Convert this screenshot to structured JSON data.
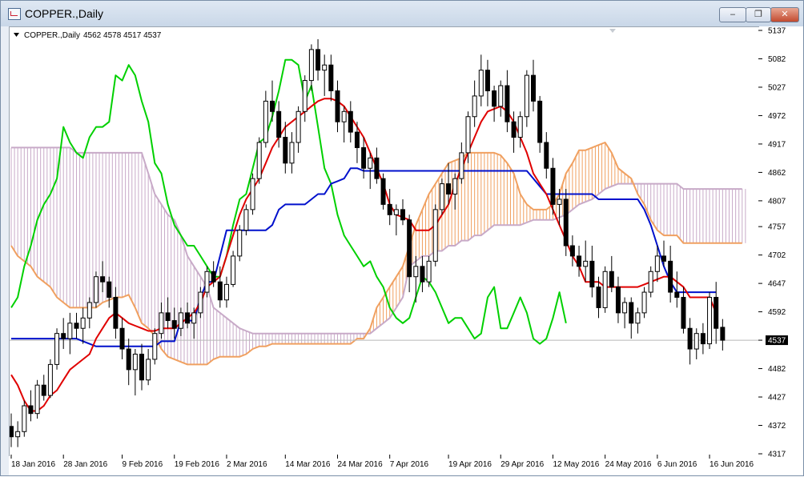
{
  "window": {
    "title": "COPPER.,Daily",
    "minimize_label": "‒",
    "restore_label": "❐",
    "close_label": "✕"
  },
  "chart_header": {
    "symbol": "COPPER.,Daily",
    "ohlc": "4562 4578 4517 4537"
  },
  "colors": {
    "tenkan": "#e00000",
    "kijun": "#0010cc",
    "chikou": "#00d000",
    "senkou_a": "#f0a060",
    "senkou_b": "#c8aac8",
    "bull_body": "#ffffff",
    "bear_body": "#000000",
    "price_line": "#b8b8b8"
  },
  "chart_data": {
    "type": "candlestick",
    "indicator": "Ichimoku Kinko Hyo",
    "ylim": [
      4317,
      5137
    ],
    "y_ticks": [
      5137,
      5082,
      5027,
      4972,
      4917,
      4862,
      4807,
      4757,
      4702,
      4647,
      4592,
      4537,
      4482,
      4427,
      4372,
      4317
    ],
    "x_tick_labels": [
      "18 Jan 2016",
      "28 Jan 2016",
      "9 Feb 2016",
      "19 Feb 2016",
      "2 Mar 2016",
      "14 Mar 2016",
      "24 Mar 2016",
      "7 Apr 2016",
      "19 Apr 2016",
      "29 Apr 2016",
      "12 May 2016",
      "24 May 2016",
      "6 Jun 2016",
      "16 Jun 2016"
    ],
    "x_tick_bars": [
      0,
      8,
      17,
      25,
      33,
      42,
      50,
      58,
      67,
      75,
      83,
      91,
      99,
      107
    ],
    "current_price": 4537,
    "candles": [
      [
        4370,
        4395,
        4330,
        4350
      ],
      [
        4350,
        4380,
        4330,
        4360
      ],
      [
        4360,
        4420,
        4350,
        4410
      ],
      [
        4410,
        4440,
        4380,
        4395
      ],
      [
        4395,
        4460,
        4385,
        4450
      ],
      [
        4450,
        4470,
        4420,
        4430
      ],
      [
        4430,
        4500,
        4425,
        4490
      ],
      [
        4490,
        4560,
        4480,
        4550
      ],
      [
        4550,
        4580,
        4520,
        4540
      ],
      [
        4540,
        4590,
        4510,
        4570
      ],
      [
        4570,
        4590,
        4540,
        4560
      ],
      [
        4560,
        4600,
        4530,
        4580
      ],
      [
        4580,
        4620,
        4560,
        4610
      ],
      [
        4610,
        4670,
        4600,
        4660
      ],
      [
        4660,
        4690,
        4630,
        4650
      ],
      [
        4650,
        4660,
        4600,
        4620
      ],
      [
        4620,
        4640,
        4540,
        4560
      ],
      [
        4560,
        4580,
        4500,
        4520
      ],
      [
        4520,
        4540,
        4450,
        4480
      ],
      [
        4480,
        4520,
        4430,
        4510
      ],
      [
        4510,
        4530,
        4440,
        4460
      ],
      [
        4460,
        4520,
        4450,
        4500
      ],
      [
        4500,
        4560,
        4490,
        4550
      ],
      [
        4550,
        4610,
        4540,
        4590
      ],
      [
        4590,
        4620,
        4560,
        4575
      ],
      [
        4575,
        4600,
        4540,
        4560
      ],
      [
        4560,
        4600,
        4545,
        4590
      ],
      [
        4590,
        4610,
        4560,
        4570
      ],
      [
        4570,
        4600,
        4540,
        4590
      ],
      [
        4590,
        4640,
        4580,
        4630
      ],
      [
        4630,
        4680,
        4620,
        4670
      ],
      [
        4670,
        4690,
        4640,
        4650
      ],
      [
        4650,
        4680,
        4600,
        4615
      ],
      [
        4615,
        4660,
        4600,
        4645
      ],
      [
        4645,
        4710,
        4640,
        4700
      ],
      [
        4700,
        4760,
        4690,
        4750
      ],
      [
        4750,
        4800,
        4740,
        4790
      ],
      [
        4790,
        4860,
        4780,
        4850
      ],
      [
        4850,
        4930,
        4840,
        4920
      ],
      [
        4920,
        5020,
        4910,
        5000
      ],
      [
        5000,
        5040,
        4960,
        4980
      ],
      [
        4980,
        5000,
        4910,
        4930
      ],
      [
        4930,
        4960,
        4860,
        4880
      ],
      [
        4880,
        4940,
        4860,
        4920
      ],
      [
        4920,
        4990,
        4900,
        4980
      ],
      [
        4980,
        5050,
        4960,
        5040
      ],
      [
        5040,
        5110,
        5020,
        5100
      ],
      [
        5100,
        5120,
        5040,
        5060
      ],
      [
        5060,
        5090,
        5010,
        5070
      ],
      [
        5070,
        5090,
        5000,
        5020
      ],
      [
        5020,
        5040,
        4940,
        4960
      ],
      [
        4960,
        4990,
        4920,
        4980
      ],
      [
        4980,
        5000,
        4920,
        4940
      ],
      [
        4940,
        4960,
        4880,
        4910
      ],
      [
        4910,
        4930,
        4850,
        4870
      ],
      [
        4870,
        4900,
        4830,
        4890
      ],
      [
        4890,
        4910,
        4840,
        4850
      ],
      [
        4850,
        4860,
        4790,
        4800
      ],
      [
        4800,
        4830,
        4760,
        4780
      ],
      [
        4780,
        4800,
        4740,
        4790
      ],
      [
        4790,
        4810,
        4760,
        4770
      ],
      [
        4770,
        4780,
        4630,
        4660
      ],
      [
        4660,
        4700,
        4610,
        4680
      ],
      [
        4680,
        4700,
        4630,
        4650
      ],
      [
        4650,
        4700,
        4640,
        4690
      ],
      [
        4690,
        4800,
        4680,
        4790
      ],
      [
        4790,
        4850,
        4780,
        4840
      ],
      [
        4840,
        4880,
        4800,
        4820
      ],
      [
        4820,
        4860,
        4790,
        4850
      ],
      [
        4850,
        4920,
        4840,
        4900
      ],
      [
        4900,
        4980,
        4880,
        4970
      ],
      [
        4970,
        5040,
        4950,
        5010
      ],
      [
        5010,
        5090,
        4990,
        5060
      ],
      [
        5060,
        5080,
        4990,
        5020
      ],
      [
        5020,
        5030,
        4960,
        4990
      ],
      [
        4990,
        5040,
        4970,
        5030
      ],
      [
        5030,
        5060,
        4940,
        4960
      ],
      [
        4960,
        4980,
        4900,
        4930
      ],
      [
        4930,
        4980,
        4910,
        4970
      ],
      [
        4970,
        5060,
        4950,
        5050
      ],
      [
        5050,
        5080,
        4980,
        5000
      ],
      [
        5000,
        5010,
        4900,
        4920
      ],
      [
        4920,
        4940,
        4850,
        4870
      ],
      [
        4870,
        4890,
        4780,
        4800
      ],
      [
        4800,
        4830,
        4760,
        4810
      ],
      [
        4810,
        4830,
        4700,
        4720
      ],
      [
        4720,
        4740,
        4680,
        4700
      ],
      [
        4700,
        4720,
        4660,
        4680
      ],
      [
        4680,
        4730,
        4650,
        4690
      ],
      [
        4690,
        4720,
        4620,
        4640
      ],
      [
        4640,
        4660,
        4580,
        4600
      ],
      [
        4600,
        4680,
        4590,
        4670
      ],
      [
        4670,
        4700,
        4630,
        4640
      ],
      [
        4640,
        4660,
        4570,
        4590
      ],
      [
        4590,
        4620,
        4560,
        4610
      ],
      [
        4610,
        4620,
        4540,
        4570
      ],
      [
        4570,
        4600,
        4550,
        4590
      ],
      [
        4590,
        4640,
        4580,
        4630
      ],
      [
        4630,
        4680,
        4620,
        4670
      ],
      [
        4670,
        4720,
        4650,
        4700
      ],
      [
        4700,
        4730,
        4680,
        4690
      ],
      [
        4690,
        4720,
        4610,
        4630
      ],
      [
        4630,
        4670,
        4600,
        4620
      ],
      [
        4620,
        4640,
        4550,
        4560
      ],
      [
        4560,
        4580,
        4490,
        4520
      ],
      [
        4520,
        4560,
        4500,
        4550
      ],
      [
        4550,
        4570,
        4510,
        4530
      ],
      [
        4530,
        4630,
        4520,
        4620
      ],
      [
        4620,
        4650,
        4530,
        4560
      ],
      [
        4562,
        4578,
        4517,
        4537
      ]
    ],
    "tenkan": [
      4470,
      4450,
      4420,
      4400,
      4400,
      4410,
      4430,
      4440,
      4460,
      4480,
      4490,
      4500,
      4510,
      4540,
      4560,
      4580,
      4590,
      4580,
      4570,
      4565,
      4560,
      4555,
      4555,
      4560,
      4560,
      4560,
      4570,
      4580,
      4590,
      4610,
      4640,
      4650,
      4660,
      4700,
      4740,
      4780,
      4810,
      4830,
      4850,
      4880,
      4910,
      4930,
      4950,
      4960,
      4970,
      4980,
      4990,
      5000,
      5005,
      5005,
      5000,
      4990,
      4970,
      4950,
      4930,
      4900,
      4870,
      4840,
      4800,
      4780,
      4775,
      4770,
      4750,
      4750,
      4750,
      4760,
      4780,
      4800,
      4840,
      4870,
      4900,
      4930,
      4960,
      4980,
      4985,
      4990,
      4980,
      4960,
      4930,
      4900,
      4860,
      4840,
      4820,
      4790,
      4760,
      4730,
      4700,
      4680,
      4650,
      4650,
      4650,
      4640,
      4640,
      4640,
      4640,
      4640,
      4640,
      4645,
      4650,
      4655,
      4660,
      4660,
      4650,
      4640,
      4620,
      4620,
      4620,
      4620,
      4590
    ],
    "kijun": [
      4540,
      4540,
      4540,
      4540,
      4540,
      4540,
      4540,
      4540,
      4540,
      4540,
      4540,
      4535,
      4530,
      4525,
      4525,
      4525,
      4525,
      4525,
      4525,
      4525,
      4525,
      4525,
      4525,
      4535,
      4535,
      4535,
      4575,
      4575,
      4575,
      4620,
      4650,
      4650,
      4700,
      4750,
      4750,
      4750,
      4750,
      4750,
      4750,
      4750,
      4760,
      4790,
      4800,
      4800,
      4800,
      4800,
      4810,
      4820,
      4820,
      4840,
      4845,
      4850,
      4870,
      4870,
      4865,
      4865,
      4865,
      4865,
      4865,
      4865,
      4865,
      4865,
      4865,
      4865,
      4865,
      4865,
      4865,
      4865,
      4865,
      4865,
      4865,
      4865,
      4865,
      4865,
      4865,
      4865,
      4865,
      4865,
      4865,
      4865,
      4850,
      4835,
      4820,
      4820,
      4820,
      4820,
      4820,
      4820,
      4820,
      4820,
      4810,
      4810,
      4810,
      4810,
      4810,
      4810,
      4810,
      4790,
      4760,
      4720,
      4680,
      4650,
      4630,
      4630,
      4630,
      4630,
      4630,
      4630,
      4630
    ],
    "chikou": [
      4600,
      4620,
      4680,
      4720,
      4770,
      4800,
      4820,
      4850,
      4950,
      4920,
      4900,
      4890,
      4930,
      4950,
      4950,
      4960,
      5050,
      5040,
      5070,
      5050,
      5000,
      4960,
      4880,
      4860,
      4800,
      4760,
      4740,
      4720,
      4720,
      4700,
      4680,
      4660,
      4660,
      4700,
      4760,
      4810,
      4820,
      4870,
      4920,
      4930,
      4970,
      5020,
      5080,
      5080,
      5070,
      5000,
      5030,
      4950,
      4870,
      4840,
      4780,
      4740,
      4720,
      4700,
      4680,
      4690,
      4660,
      4640,
      4600,
      4580,
      4570,
      4580,
      4620,
      4660,
      4650,
      4630,
      4600,
      4570,
      4580,
      4580,
      4560,
      4540,
      4550,
      4620,
      4640,
      4560,
      4560,
      4590,
      4620,
      4590,
      4540,
      4530,
      4540,
      4580,
      4630,
      4570
    ],
    "senkou_a": [
      4720,
      4700,
      4690,
      4680,
      4660,
      4650,
      4640,
      4620,
      4610,
      4600,
      4600,
      4600,
      4600,
      4600,
      4610,
      4615,
      4620,
      4620,
      4625,
      4600,
      4570,
      4560,
      4545,
      4520,
      4505,
      4500,
      4495,
      4490,
      4490,
      4490,
      4490,
      4500,
      4505,
      4505,
      4505,
      4505,
      4510,
      4520,
      4525,
      4525,
      4530,
      4530,
      4530,
      4530,
      4530,
      4530,
      4530,
      4530,
      4530,
      4530,
      4530,
      4530,
      4530,
      4540,
      4540,
      4560,
      4600,
      4620,
      4640,
      4660,
      4680,
      4720,
      4760,
      4790,
      4820,
      4840,
      4860,
      4880,
      4885,
      4890,
      4900,
      4900,
      4900,
      4900,
      4900,
      4895,
      4880,
      4860,
      4820,
      4800,
      4790,
      4790,
      4790,
      4800,
      4820,
      4860,
      4880,
      4905,
      4905,
      4910,
      4915,
      4920,
      4900,
      4870,
      4860,
      4850,
      4820,
      4800,
      4770,
      4750,
      4740,
      4740,
      4740,
      4725,
      4725,
      4725,
      4725,
      4725,
      4725,
      4725,
      4725,
      4725,
      4725
    ],
    "senkou_b": [
      4910,
      4910,
      4910,
      4910,
      4910,
      4910,
      4910,
      4910,
      4910,
      4910,
      4900,
      4900,
      4900,
      4900,
      4900,
      4900,
      4900,
      4900,
      4900,
      4900,
      4900,
      4860,
      4820,
      4800,
      4780,
      4770,
      4740,
      4700,
      4680,
      4660,
      4640,
      4600,
      4590,
      4580,
      4570,
      4560,
      4555,
      4550,
      4550,
      4550,
      4550,
      4550,
      4550,
      4550,
      4550,
      4550,
      4550,
      4550,
      4550,
      4550,
      4550,
      4550,
      4550,
      4550,
      4550,
      4550,
      4560,
      4570,
      4580,
      4600,
      4620,
      4680,
      4690,
      4700,
      4700,
      4710,
      4710,
      4720,
      4720,
      4730,
      4730,
      4740,
      4740,
      4750,
      4760,
      4760,
      4760,
      4760,
      4760,
      4765,
      4770,
      4770,
      4770,
      4770,
      4775,
      4780,
      4790,
      4800,
      4805,
      4810,
      4820,
      4830,
      4835,
      4840,
      4840,
      4840,
      4840,
      4840,
      4840,
      4840,
      4840,
      4840,
      4840,
      4830,
      4830,
      4830,
      4830,
      4830,
      4830,
      4830,
      4830,
      4830,
      4830
    ]
  }
}
